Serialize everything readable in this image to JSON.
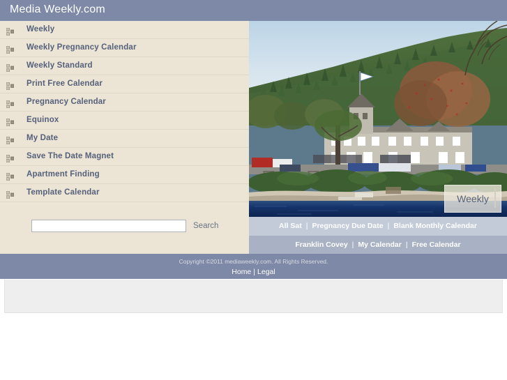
{
  "header": {
    "site_title": "Media Weekly.com"
  },
  "sidebar": {
    "items": [
      {
        "label": "Weekly",
        "icon": "list-bullet-icon"
      },
      {
        "label": "Weekly Pregnancy Calendar",
        "icon": "list-bullet-icon"
      },
      {
        "label": "Weekly Standard",
        "icon": "list-bullet-icon"
      },
      {
        "label": "Print Free Calendar",
        "icon": "list-bullet-icon"
      },
      {
        "label": "Pregnancy Calendar",
        "icon": "list-bullet-icon"
      },
      {
        "label": "Equinox",
        "icon": "list-bullet-icon"
      },
      {
        "label": "My Date",
        "icon": "list-bullet-icon"
      },
      {
        "label": "Save The Date Magnet",
        "icon": "list-bullet-icon"
      },
      {
        "label": "Apartment Finding",
        "icon": "list-bullet-icon"
      },
      {
        "label": "Template Calendar",
        "icon": "list-bullet-icon"
      }
    ]
  },
  "search": {
    "value": "",
    "placeholder": "",
    "button_label": "Search"
  },
  "hero": {
    "badge_label": "Weekly",
    "image_description": "Riverside stone hotel building with flagpole, wooded hillside and lake"
  },
  "footer": {
    "row1": [
      {
        "label": "All Sat"
      },
      {
        "label": "Pregnancy Due Date"
      },
      {
        "label": "Blank Monthly Calendar"
      }
    ],
    "row2": [
      {
        "label": "Franklin Covey"
      },
      {
        "label": "My Calendar"
      },
      {
        "label": "Free Calendar"
      }
    ],
    "separator": "|",
    "copyright": "Copyright ©2011 mediaweekly.com. All Rights Reserved.",
    "bottom_links": [
      {
        "label": "Home"
      },
      {
        "label": "Legal"
      }
    ],
    "bottom_separator": "|"
  },
  "colors": {
    "header_bg": "#7d89a6",
    "sidebar_bg": "#ece5d5",
    "nav_text": "#55607a",
    "footer_row1_bg": "#c3cbd9",
    "footer_row2_bg": "#a9b1c4",
    "copybar_bg": "#7d89a6",
    "page_bg": "#ffffff"
  }
}
